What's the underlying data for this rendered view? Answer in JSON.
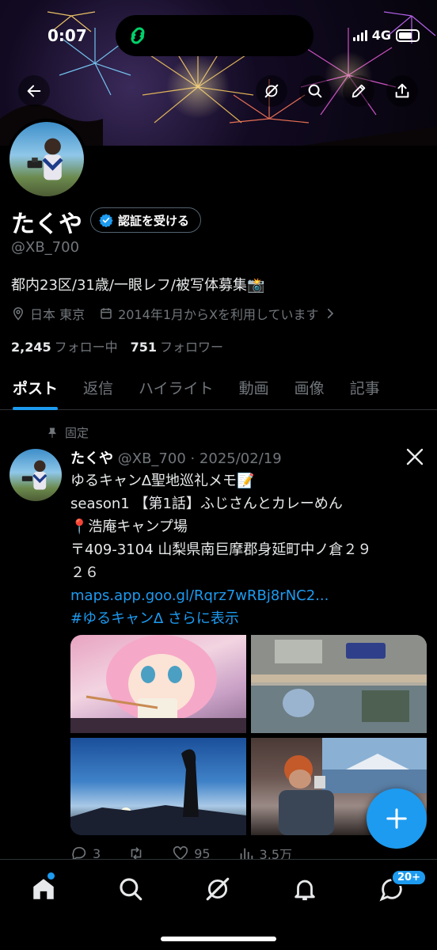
{
  "status_bar": {
    "time": "0:07",
    "network": "4G"
  },
  "profile": {
    "name": "たくや",
    "verify_label": "認証を受ける",
    "handle": "@XB_700",
    "bio": "都内23区/31歳/一眼レフ/被写体募集📸",
    "location": "日本 東京",
    "joined": "2014年1月からXを利用しています",
    "following_count": "2,245",
    "following_label": "フォロー中",
    "followers_count": "751",
    "followers_label": "フォロワー"
  },
  "tabs": [
    {
      "label": "ポスト"
    },
    {
      "label": "返信"
    },
    {
      "label": "ハイライト"
    },
    {
      "label": "動画"
    },
    {
      "label": "画像"
    },
    {
      "label": "記事"
    }
  ],
  "tweet": {
    "pinned_label": "固定",
    "name": "たくや",
    "handle_date": "@XB_700 · 2025/02/19",
    "lines": [
      "ゆるキャン∆聖地巡礼メモ📝",
      "season1 【第1話】ふじさんとカレーめん",
      "📍浩庵キャンプ場",
      "〒409-3104 山梨県南巨摩郡身延町中ノ倉２９",
      "２６"
    ],
    "link": "maps.app.goo.gl/Rqrz7wRBj8rNC2...",
    "hashtag": "#ゆるキャン∆",
    "show_more": "さらに表示",
    "replies": "3",
    "likes": "95",
    "views": "3.5万"
  },
  "bottom_nav": {
    "messages_badge": "20+"
  },
  "colors": {
    "accent": "#1d9bf0",
    "background": "#000000",
    "muted": "#71767b"
  }
}
